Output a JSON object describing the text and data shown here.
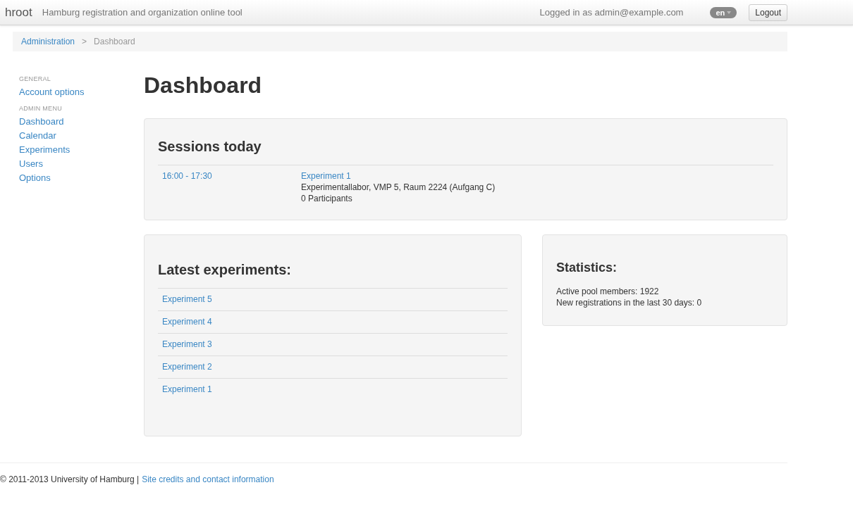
{
  "navbar": {
    "brand": "hroot",
    "tagline": "Hamburg registration and organization online tool",
    "login_text": "Logged in as admin@example.com",
    "language": "en",
    "logout_button": "Logout"
  },
  "breadcrumb": {
    "items": [
      "Administration",
      "Dashboard"
    ],
    "separator": ">"
  },
  "sidebar": {
    "sections": [
      {
        "header": "GENERAL",
        "items": [
          "Account options"
        ]
      },
      {
        "header": "ADMIN MENU",
        "items": [
          "Dashboard",
          "Calendar",
          "Experiments",
          "Users",
          "Options"
        ]
      }
    ]
  },
  "page_title": "Dashboard",
  "sessions_today": {
    "title": "Sessions today",
    "sessions": [
      {
        "time": "16:00 - 17:30",
        "experiment": "Experiment 1",
        "location": "Experimentallabor, VMP 5, Raum 2224 (Aufgang C)",
        "participants": "0 Participants"
      }
    ]
  },
  "latest_experiments": {
    "title": "Latest experiments:",
    "items": [
      "Experiment 5",
      "Experiment 4",
      "Experiment 3",
      "Experiment 2",
      "Experiment 1"
    ]
  },
  "statistics": {
    "title": "Statistics:",
    "lines": [
      "Active pool members: 1922",
      "New registrations in the last 30 days: 0"
    ]
  },
  "footer": {
    "copyright": "© 2011-2013 University of Hamburg |",
    "link": "Site credits and contact information"
  }
}
